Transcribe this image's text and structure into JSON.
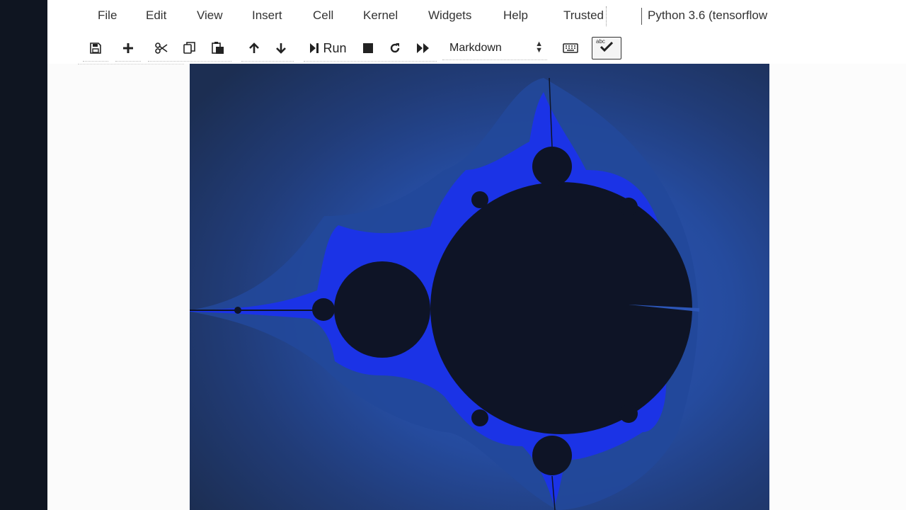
{
  "menubar": {
    "items": [
      "File",
      "Edit",
      "View",
      "Insert",
      "Cell",
      "Kernel",
      "Widgets",
      "Help"
    ],
    "trusted": "Trusted",
    "kernel": "Python 3.6 (tensorflow"
  },
  "toolbar": {
    "run_label": "Run",
    "cell_type": "Markdown",
    "icons": [
      "save-icon",
      "plus-icon",
      "cut-icon",
      "copy-icon",
      "paste-icon",
      "arrow-up-icon",
      "arrow-down-icon",
      "run-icon",
      "stop-icon",
      "restart-icon",
      "fast-forward-icon",
      "keyboard-icon",
      "spellcheck-icon"
    ]
  },
  "colors": {
    "background_outer": "#1c2e52",
    "background_mid": "#1e3f8a",
    "band_bright": "#1b33e6",
    "set_interior": "#0e1426"
  }
}
